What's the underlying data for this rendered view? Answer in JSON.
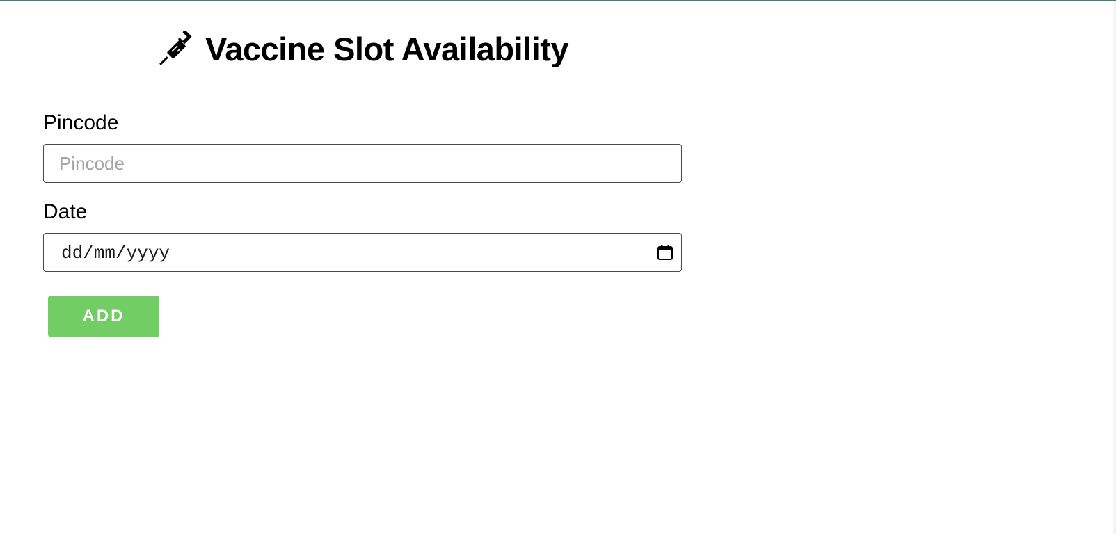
{
  "header": {
    "title": "Vaccine Slot Availability",
    "icon": "syringe-icon"
  },
  "form": {
    "pincode": {
      "label": "Pincode",
      "placeholder": "Pincode",
      "value": ""
    },
    "date": {
      "label": "Date",
      "placeholder": "dd/mm/yyyy",
      "icon": "calendar-icon"
    },
    "submit_label": "ADD"
  },
  "colors": {
    "accent_top_border": "#3b7f7f",
    "button_bg": "#72cd65",
    "button_text": "#ffffff",
    "placeholder_text": "#a3a3a3"
  }
}
